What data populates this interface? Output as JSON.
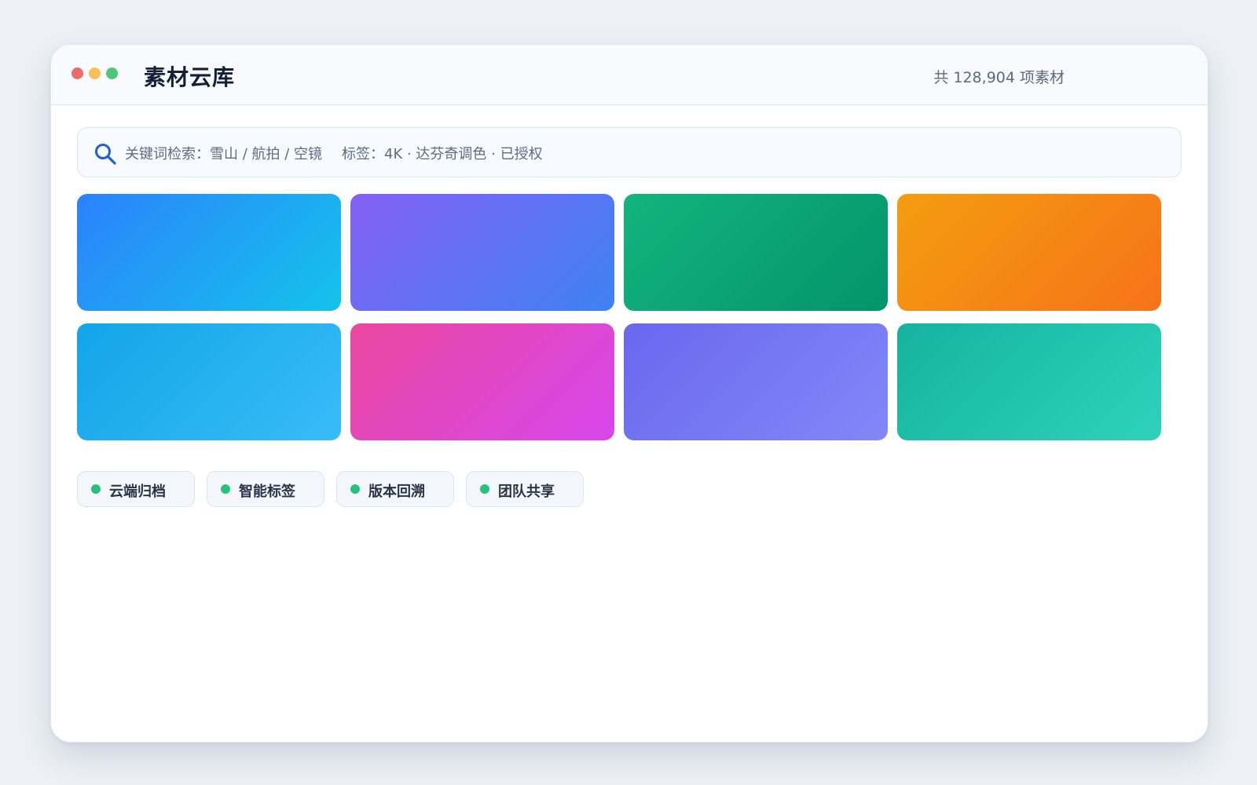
{
  "window": {
    "title": "素材云库",
    "asset_count": "共 128,904 项素材"
  },
  "search": {
    "query_text": "关键词检索：雪山 / 航拍 / 空镜",
    "tags_text": "标签：4K · 达芬奇调色 · 已授权"
  },
  "tiles": [
    {
      "from": "#2b82fc",
      "to": "#14c3ea"
    },
    {
      "from": "#8560f4",
      "to": "#3d82f4"
    },
    {
      "from": "#13b47d",
      "to": "#03946a"
    },
    {
      "from": "#f49d0f",
      "to": "#f67319"
    },
    {
      "from": "#12a5e8",
      "to": "#38bcf6"
    },
    {
      "from": "#ea489f",
      "to": "#d746ec"
    },
    {
      "from": "#6a67ee",
      "to": "#8188f8"
    },
    {
      "from": "#15b39f",
      "to": "#2ed2bb"
    }
  ],
  "features": [
    {
      "label": "云端归档"
    },
    {
      "label": "智能标签"
    },
    {
      "label": "版本回溯"
    },
    {
      "label": "团队共享"
    }
  ],
  "colors": {
    "feature_dot": "#25c27a",
    "window_controls": [
      "#ef6b6b",
      "#f8c056",
      "#4cc777"
    ]
  }
}
